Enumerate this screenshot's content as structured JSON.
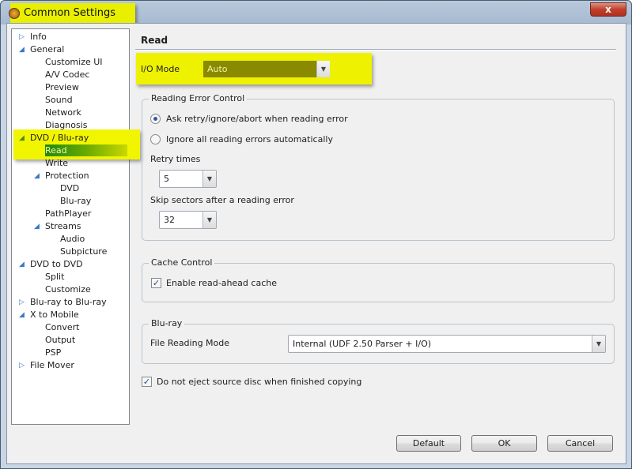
{
  "window": {
    "title": "Common Settings",
    "close": "x"
  },
  "tree": [
    {
      "label": "Info",
      "level": 0,
      "expander": "collapsed"
    },
    {
      "label": "General",
      "level": 0,
      "expander": "expanded"
    },
    {
      "label": "Customize UI",
      "level": 2
    },
    {
      "label": "A/V Codec",
      "level": 2
    },
    {
      "label": "Preview",
      "level": 2
    },
    {
      "label": "Sound",
      "level": 2
    },
    {
      "label": "Network",
      "level": 2
    },
    {
      "label": "Diagnosis",
      "level": 2
    },
    {
      "label": "DVD / Blu-ray",
      "level": 0,
      "expander": "expanded"
    },
    {
      "label": "Read",
      "level": 2,
      "selected": true
    },
    {
      "label": "Write",
      "level": 2
    },
    {
      "label": "Protection",
      "level": 1,
      "expander": "expanded"
    },
    {
      "label": "DVD",
      "level": 3
    },
    {
      "label": "Blu-ray",
      "level": 3
    },
    {
      "label": "PathPlayer",
      "level": 2
    },
    {
      "label": "Streams",
      "level": 1,
      "expander": "expanded"
    },
    {
      "label": "Audio",
      "level": 3
    },
    {
      "label": "Subpicture",
      "level": 3
    },
    {
      "label": "DVD to DVD",
      "level": 0,
      "expander": "expanded"
    },
    {
      "label": "Split",
      "level": 2
    },
    {
      "label": "Customize",
      "level": 2
    },
    {
      "label": "Blu-ray to Blu-ray",
      "level": 0,
      "expander": "collapsed"
    },
    {
      "label": "X to Mobile",
      "level": 0,
      "expander": "expanded"
    },
    {
      "label": "Convert",
      "level": 2
    },
    {
      "label": "Output",
      "level": 2
    },
    {
      "label": "PSP",
      "level": 2
    },
    {
      "label": "File Mover",
      "level": 0,
      "expander": "collapsed"
    }
  ],
  "page": {
    "header": "Read",
    "io_mode": {
      "label": "I/O Mode",
      "value": "Auto"
    },
    "reading_error": {
      "title": "Reading Error Control",
      "option1": "Ask retry/ignore/abort when reading error",
      "option2": "Ignore all reading errors automatically",
      "selected": 1,
      "retry_label": "Retry times",
      "retry_value": "5",
      "skip_label": "Skip sectors after a reading error",
      "skip_value": "32"
    },
    "cache": {
      "title": "Cache Control",
      "enable_label": "Enable read-ahead cache",
      "enabled": true
    },
    "bluray": {
      "title": "Blu-ray",
      "mode_label": "File Reading Mode",
      "mode_value": "Internal (UDF 2.50 Parser + I/O)"
    },
    "no_eject": {
      "label": "Do not eject source disc when finished copying",
      "checked": true
    }
  },
  "buttons": {
    "default": "Default",
    "ok": "OK",
    "cancel": "Cancel"
  },
  "colors": {
    "highlight": "#f2f500",
    "selection": "#1e8a10"
  }
}
